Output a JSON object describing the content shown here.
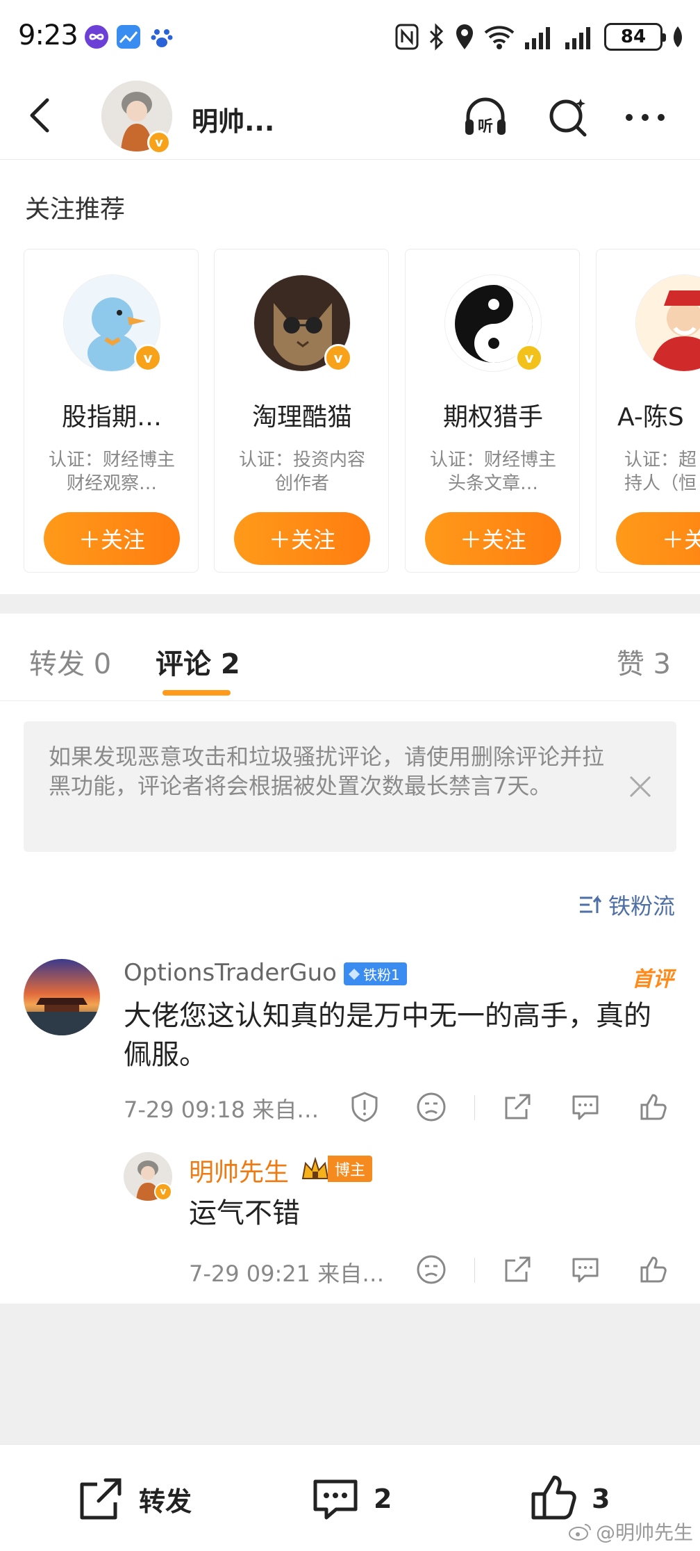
{
  "status_bar": {
    "time": "9:23",
    "battery": "84"
  },
  "header": {
    "title": "明帅..."
  },
  "recommendations": {
    "title": "关注推荐",
    "cards": [
      {
        "name": "股指期…",
        "desc": "认证：财经博主 财经观察…",
        "follow": "＋关注"
      },
      {
        "name": "淘理酷猫",
        "desc": "认证：投资内容创作者",
        "follow": "＋关注"
      },
      {
        "name": "期权猎手",
        "desc": "认证：财经博主 头条文章…",
        "follow": "＋关注"
      },
      {
        "name": "A-陈S",
        "desc": "认证：超持人（恒",
        "follow": "＋关"
      }
    ]
  },
  "tabs": {
    "repost": "转发 0",
    "comments": "评论 2",
    "likes": "赞 3"
  },
  "notice": {
    "text": "如果发现恶意攻击和垃圾骚扰评论，请使用删除评论并拉黑功能，评论者将会根据被处置次数最长禁言7天。"
  },
  "sort": {
    "label": "铁粉流"
  },
  "comments": [
    {
      "user": "OptionsTraderGuo",
      "badge": "铁粉1",
      "tag": "首评",
      "text": "大佬您这认知真的是万中无一的高手，真的佩服。",
      "meta": "7-29 09:18  来自…"
    }
  ],
  "reply": {
    "user": "明帅先生",
    "tag": "博主",
    "text": "运气不错",
    "meta": "7-29 09:21  来自…"
  },
  "bottom_bar": {
    "repost": "转发",
    "comments": "2",
    "likes": "3"
  },
  "watermark": "@明帅先生",
  "colors": {
    "accent": "#ff8a1a",
    "link": "#4f6fa7",
    "fan_badge": "#3b8cf0"
  }
}
